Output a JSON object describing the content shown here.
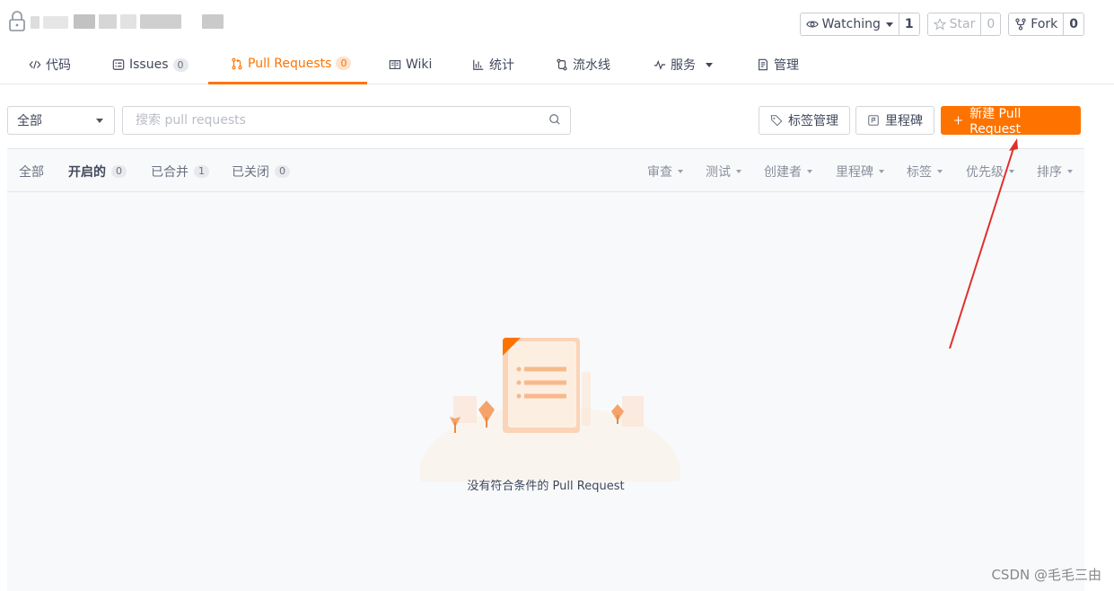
{
  "header": {
    "repo_name_hidden": "",
    "actions": {
      "watch": {
        "label": "Watching",
        "count": "1"
      },
      "star": {
        "label": "Star",
        "count": "0"
      },
      "fork": {
        "label": "Fork",
        "count": "0"
      }
    }
  },
  "tabs": [
    {
      "label": "代码",
      "icon": "code-icon"
    },
    {
      "label": "Issues",
      "count": "0",
      "icon": "issues-icon"
    },
    {
      "label": "Pull Requests",
      "count": "0",
      "icon": "pull-request-icon",
      "active": true
    },
    {
      "label": "Wiki",
      "icon": "wiki-icon"
    },
    {
      "label": "统计",
      "icon": "chart-icon"
    },
    {
      "label": "流水线",
      "icon": "pipeline-icon"
    },
    {
      "label": "服务",
      "icon": "pulse-icon"
    },
    {
      "label": "管理",
      "icon": "manage-icon"
    }
  ],
  "toolbar": {
    "filter_value": "全部",
    "search_placeholder": "搜索 pull requests",
    "labels_button": "标签管理",
    "milestones_button": "里程碑",
    "new_pr_button": "新建 Pull Request"
  },
  "state_tabs": [
    {
      "label": "全部"
    },
    {
      "label": "开启的",
      "count": "0",
      "active": true
    },
    {
      "label": "已合并",
      "count": "1"
    },
    {
      "label": "已关闭",
      "count": "0"
    }
  ],
  "sort_filters": [
    "审查",
    "测试",
    "创建者",
    "里程碑",
    "标签",
    "优先级",
    "排序"
  ],
  "empty_state": {
    "message": "没有符合条件的 Pull Request"
  },
  "watermark": "CSDN @毛毛三由",
  "colors": {
    "accent": "#fe7300",
    "annotation_arrow": "#e0302a"
  }
}
